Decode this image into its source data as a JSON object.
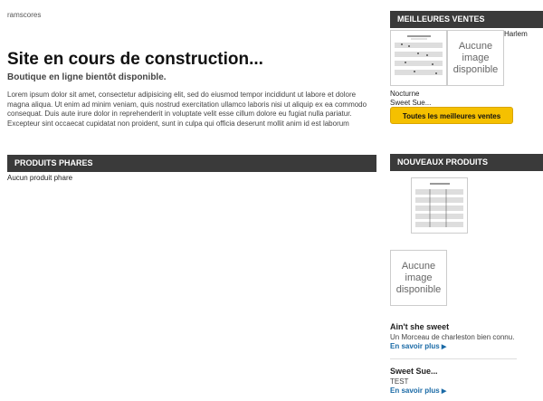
{
  "site_name": "ramscores",
  "main": {
    "title": "Site en cours de construction...",
    "subtitle": "Boutique en ligne bientôt disponible.",
    "lorem": "Lorem ipsum dolor sit amet, consectetur adipisicing elit, sed do eiusmod tempor incididunt ut labore et dolore magna aliqua. Ut enim ad minim veniam, quis nostrud exercitation ullamco laboris nisi ut aliquip ex ea commodo consequat. Duis aute irure dolor in reprehenderit in voluptate velit esse cillum dolore eu fugiat nulla pariatur. Excepteur sint occaecat cupidatat non proident, sunt in culpa qui officia deserunt mollit anim id est laborum"
  },
  "featured": {
    "heading": "Produits phares",
    "empty_text": "Aucun produit phare"
  },
  "bestsellers": {
    "heading": "Meilleures ventes",
    "no_image": "Aucune image disponible",
    "item_harlem": "Harlem",
    "item_nocturne": "Nocturne",
    "item_sweet": "Sweet Sue...",
    "all_button": "Toutes les meilleures ventes"
  },
  "new_products": {
    "heading": "Nouveaux produits",
    "no_image": "Aucune image disponible",
    "products": [
      {
        "name": "Ain't she sweet",
        "desc": "Un Morceau de charleston bien connu.",
        "more": "En savoir plus"
      },
      {
        "name": "Sweet Sue...",
        "desc": "TEST",
        "more": "En savoir plus"
      }
    ]
  },
  "icons": {
    "arrow": "triangle-right-icon"
  }
}
